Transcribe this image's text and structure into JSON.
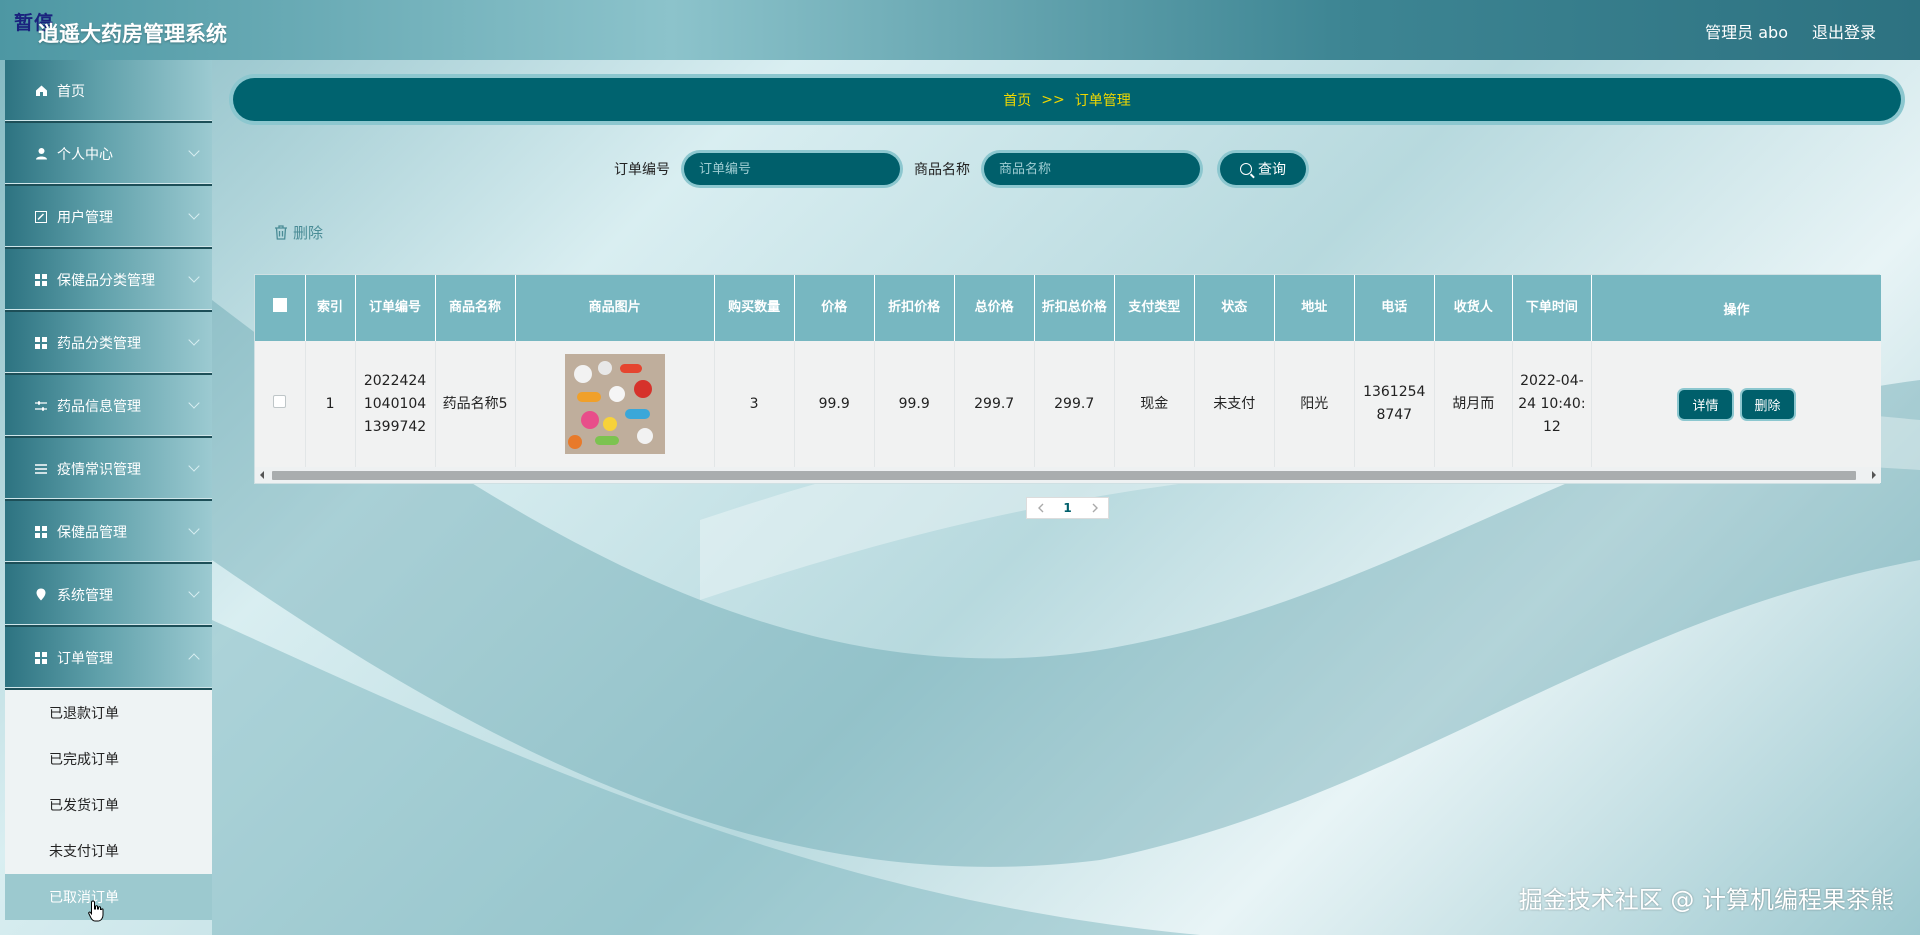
{
  "header": {
    "paused_tag": "暂停",
    "app_title": "逍遥大药房管理系统",
    "admin_label": "管理员 abo",
    "logout_label": "退出登录"
  },
  "sidebar": {
    "items": [
      {
        "label": "首页",
        "icon": "home-icon"
      },
      {
        "label": "个人中心",
        "icon": "user-icon"
      },
      {
        "label": "用户管理",
        "icon": "edit-icon"
      },
      {
        "label": "保健品分类管理",
        "icon": "grid-icon"
      },
      {
        "label": "药品分类管理",
        "icon": "grid-icon"
      },
      {
        "label": "药品信息管理",
        "icon": "sliders-icon"
      },
      {
        "label": "疫情常识管理",
        "icon": "list-icon"
      },
      {
        "label": "保健品管理",
        "icon": "grid-icon"
      },
      {
        "label": "系统管理",
        "icon": "pin-icon"
      },
      {
        "label": "订单管理",
        "icon": "grid-icon"
      }
    ],
    "sub_items": [
      {
        "label": "已退款订单"
      },
      {
        "label": "已完成订单"
      },
      {
        "label": "已发货订单"
      },
      {
        "label": "未支付订单"
      },
      {
        "label": "已取消订单"
      }
    ]
  },
  "breadcrumb": {
    "home": "首页",
    "sep": ">>",
    "current": "订单管理"
  },
  "search": {
    "order_no_label": "订单编号",
    "order_no_placeholder": "订单编号",
    "product_label": "商品名称",
    "product_placeholder": "商品名称",
    "query_label": "查询"
  },
  "toolbar": {
    "delete_label": "删除"
  },
  "table": {
    "headers": {
      "index": "索引",
      "order_no": "订单编号",
      "product_name": "商品名称",
      "product_image": "商品图片",
      "quantity": "购买数量",
      "price": "价格",
      "discount_price": "折扣价格",
      "total_price": "总价格",
      "discount_total": "折扣总价格",
      "pay_type": "支付类型",
      "status": "状态",
      "address": "地址",
      "phone": "电话",
      "receiver": "收货人",
      "order_time": "下单时间",
      "ops": "操作"
    },
    "rows": [
      {
        "index": "1",
        "order_no": "20224241040104 1399742",
        "product_name": "药品名称5",
        "quantity": "3",
        "price": "99.9",
        "discount_price": "99.9",
        "total_price": "299.7",
        "discount_total": "299.7",
        "pay_type": "现金",
        "status": "未支付",
        "address": "阳光",
        "phone": "13612548747",
        "receiver": "胡月而",
        "order_time": "2022-04-24 10:40:12",
        "detail_label": "详情",
        "delete_label": "删除"
      }
    ]
  },
  "pagination": {
    "current": "1"
  },
  "watermark": "掘金技术社区 @ 计算机编程果茶熊",
  "colors": {
    "primary": "#005f6b",
    "breadcrumb_text": "#f0d700",
    "header_row": "#77b7c1"
  }
}
